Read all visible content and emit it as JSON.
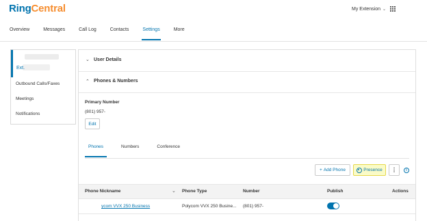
{
  "brand": {
    "part1": "Ring",
    "part2": "Central"
  },
  "header": {
    "extension_menu": "My Extension"
  },
  "nav": {
    "tabs": [
      "Overview",
      "Messages",
      "Call Log",
      "Contacts",
      "Settings",
      "More"
    ],
    "active": "Settings"
  },
  "sidebar": {
    "user_ext": "Ext.",
    "items": [
      "Outbound Calls/Faxes",
      "Meetings",
      "Notifications"
    ]
  },
  "sections": {
    "user_details": "User Details",
    "phones_numbers": "Phones & Numbers"
  },
  "primary": {
    "label": "Primary Number",
    "value": "(801) 957-",
    "edit": "Edit"
  },
  "subtabs": [
    "Phones",
    "Numbers",
    "Conference"
  ],
  "actions": {
    "add_phone": "Add Phone",
    "presence": "Presence"
  },
  "table": {
    "headers": [
      "Phone Nickname",
      "Phone Type",
      "Number",
      "Publish",
      "Actions"
    ],
    "rows": [
      {
        "nickname": "ycom VVX 250 Business",
        "type": "Polycom VVX 250 Busine...",
        "number": "(801) 957-",
        "publish": true
      }
    ]
  },
  "colors": {
    "accent": "#0073ae",
    "brand_orange": "#f68d2e",
    "highlight": "#fafbc7"
  }
}
